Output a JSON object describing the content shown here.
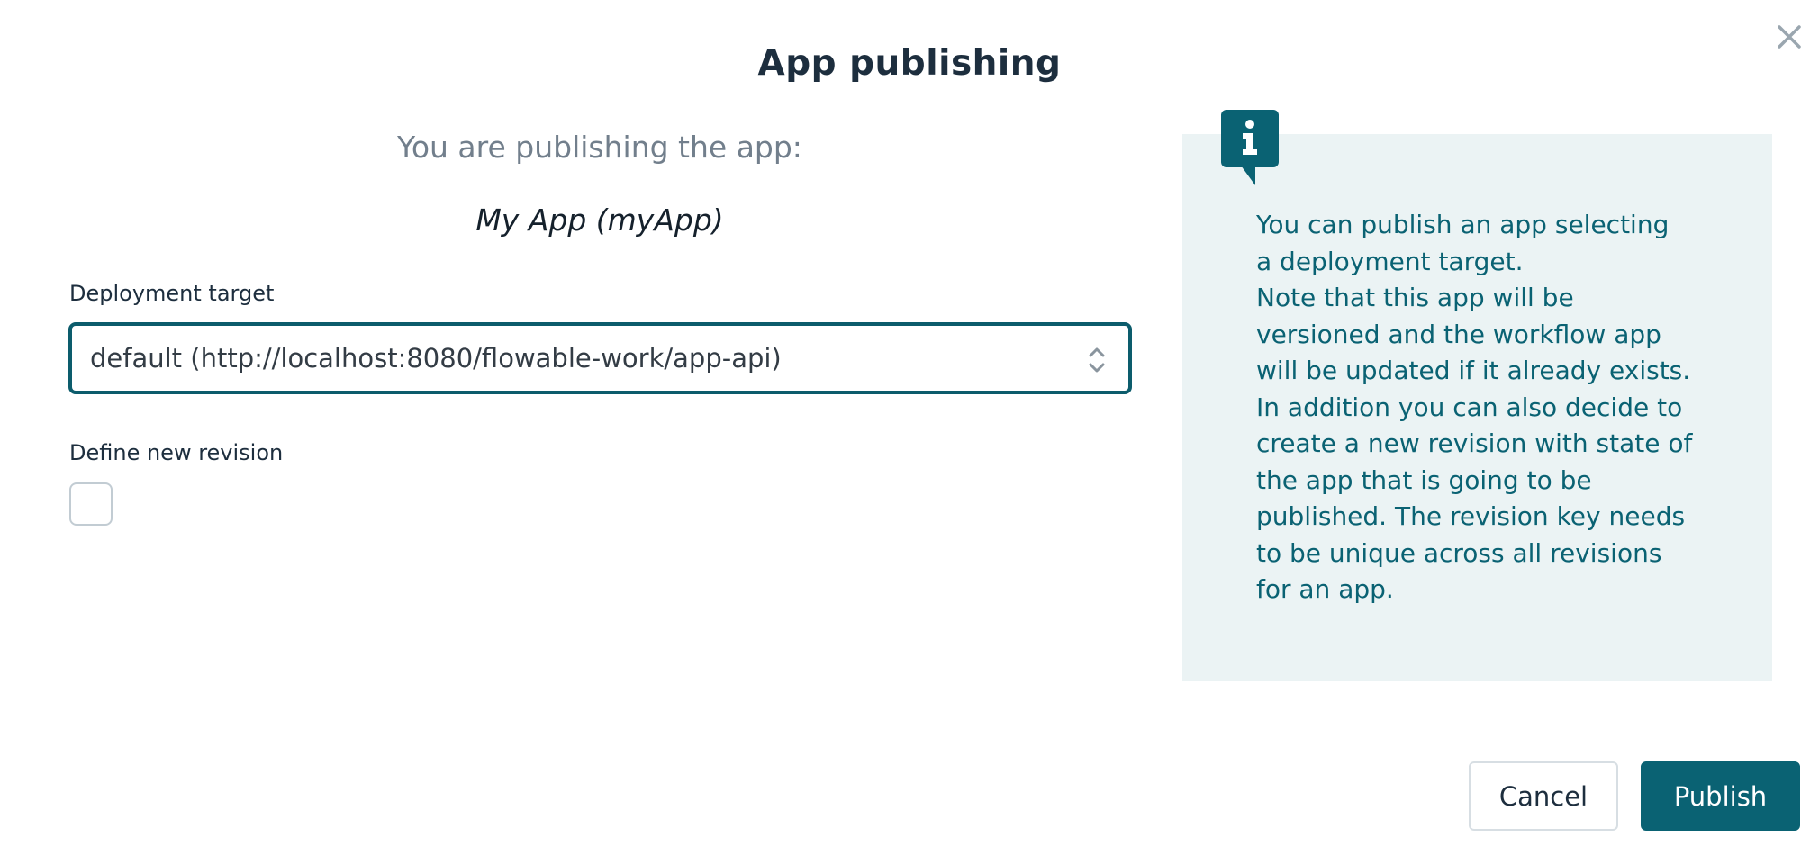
{
  "dialog": {
    "title": "App publishing",
    "intro": "You are publishing the app:",
    "app_name": "My App (myApp)"
  },
  "deployment_target": {
    "label": "Deployment target",
    "selected_value": "default (http://localhost:8080/flowable-work/app-api)"
  },
  "revision": {
    "label": "Define new revision",
    "checked": false
  },
  "info": {
    "icon": "info-icon",
    "text": "You can publish an app selecting\na deployment target.\nNote that this app will be\nversioned and the workflow app\nwill be updated if it already exists.\nIn addition you can also decide to\ncreate a new revision with state of\nthe app that is going to be\npublished. The revision key needs\nto be unique across all revisions\nfor an app."
  },
  "actions": {
    "cancel_label": "Cancel",
    "publish_label": "Publish"
  },
  "colors": {
    "accent": "#0a6273",
    "title": "#1d2e3e",
    "info_background": "#ebf3f4",
    "muted_text": "#727f8c"
  }
}
